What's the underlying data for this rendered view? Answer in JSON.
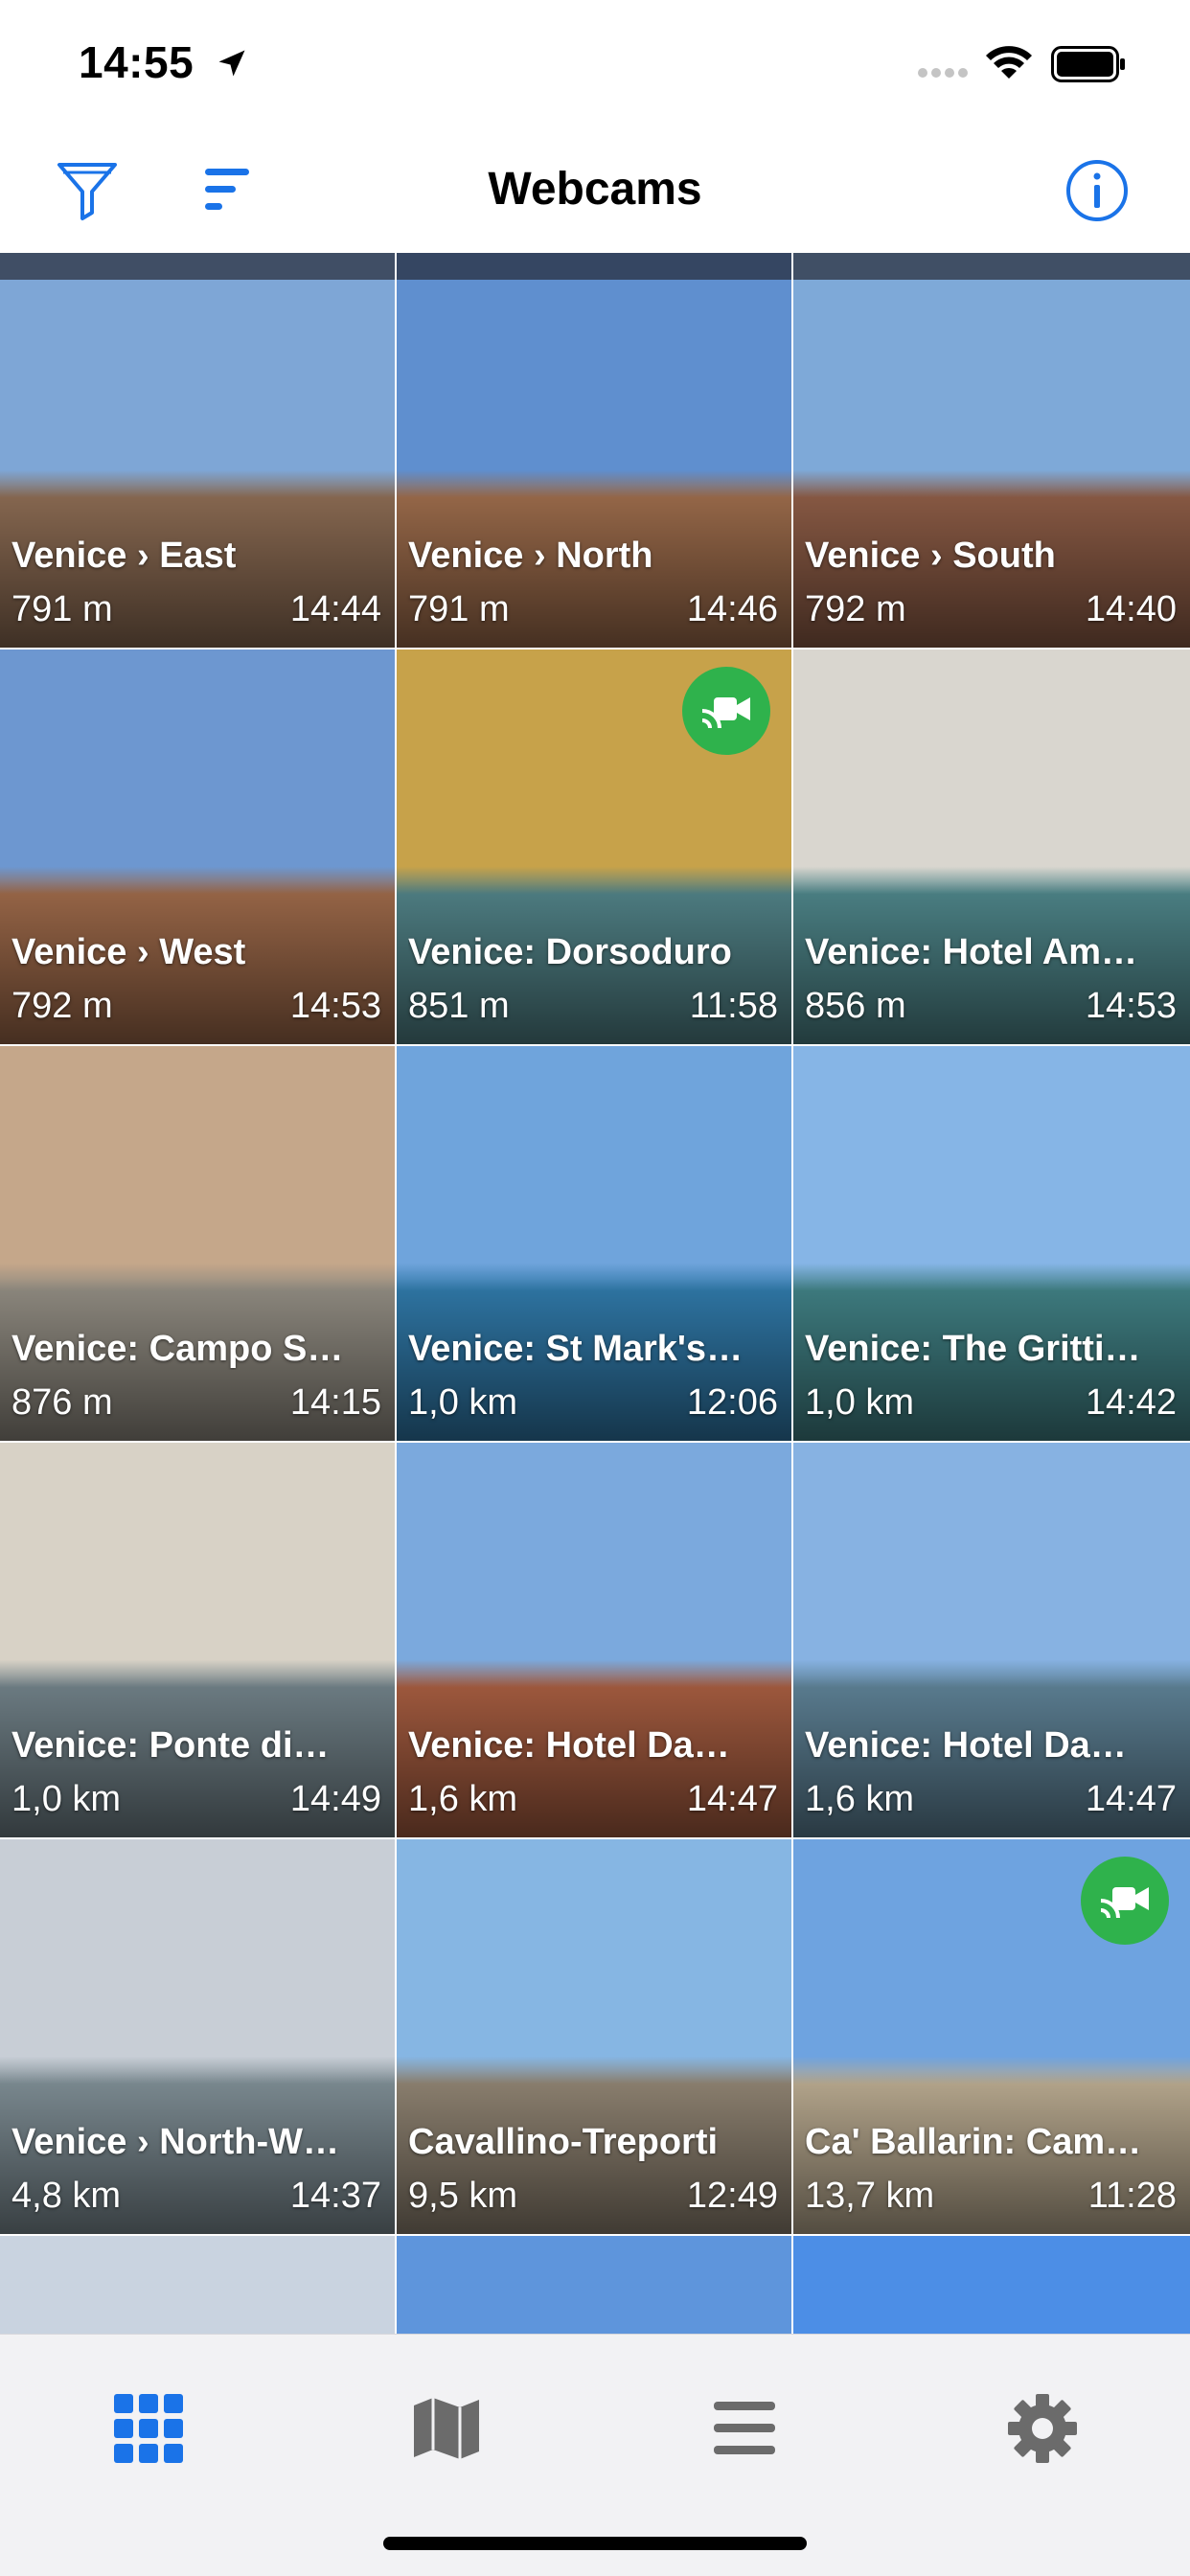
{
  "status_bar": {
    "time": "14:55"
  },
  "nav": {
    "title": "Webcams"
  },
  "webcams": [
    {
      "title": "Venice › East",
      "distance": "791 m",
      "time": "14:44",
      "stream": false,
      "sky": "#7ea6d6",
      "ground": "#8a6a52"
    },
    {
      "title": "Venice › North",
      "distance": "791 m",
      "time": "14:46",
      "stream": false,
      "sky": "#5f8fcf",
      "ground": "#9a6a4a"
    },
    {
      "title": "Venice › South",
      "distance": "792 m",
      "time": "14:40",
      "stream": false,
      "sky": "#7ea9d8",
      "ground": "#8b5b45"
    },
    {
      "title": "Venice › West",
      "distance": "792 m",
      "time": "14:53",
      "stream": false,
      "sky": "#6d97d0",
      "ground": "#9a6748"
    },
    {
      "title": "Venice: Dorsoduro",
      "distance": "851 m",
      "time": "11:58",
      "stream": true,
      "sky": "#c7a24a",
      "ground": "#4f7f84"
    },
    {
      "title": "Venice: Hotel Am…",
      "distance": "856 m",
      "time": "14:53",
      "stream": false,
      "sky": "#d9d6cf",
      "ground": "#4c8286"
    },
    {
      "title": "Venice: Campo S…",
      "distance": "876 m",
      "time": "14:15",
      "stream": false,
      "sky": "#c5a78a",
      "ground": "#8f8a80"
    },
    {
      "title": "Venice: St Mark's…",
      "distance": "1,0 km",
      "time": "12:06",
      "stream": false,
      "sky": "#6fa4dc",
      "ground": "#2f77a6"
    },
    {
      "title": "Venice: The Gritti…",
      "distance": "1,0 km",
      "time": "14:42",
      "stream": false,
      "sky": "#86b5e6",
      "ground": "#3f7e82"
    },
    {
      "title": "Venice: Ponte di…",
      "distance": "1,0 km",
      "time": "14:49",
      "stream": false,
      "sky": "#d8d2c6",
      "ground": "#6f7f86"
    },
    {
      "title": "Venice: Hotel Da…",
      "distance": "1,6 km",
      "time": "14:47",
      "stream": false,
      "sky": "#7ba9dd",
      "ground": "#a35b3f"
    },
    {
      "title": "Venice: Hotel Da…",
      "distance": "1,6 km",
      "time": "14:47",
      "stream": false,
      "sky": "#87b2e2",
      "ground": "#5c7f93"
    },
    {
      "title": "Venice › North-W…",
      "distance": "4,8 km",
      "time": "14:37",
      "stream": false,
      "sky": "#c8ced6",
      "ground": "#7d8c93"
    },
    {
      "title": "Cavallino-Treporti",
      "distance": "9,5 km",
      "time": "12:49",
      "stream": false,
      "sky": "#86b6e3",
      "ground": "#8e8271"
    },
    {
      "title": "Ca' Ballarin: Cam…",
      "distance": "13,7 km",
      "time": "11:28",
      "stream": true,
      "sky": "#6ea3e0",
      "ground": "#b8a98f"
    },
    {
      "title": "",
      "distance": "",
      "time": "",
      "stream": false,
      "sky": "#c9d3e0",
      "ground": "#c9d3e0"
    },
    {
      "title": "",
      "distance": "",
      "time": "",
      "stream": false,
      "sky": "#5e95dc",
      "ground": "#5e95dc"
    },
    {
      "title": "",
      "distance": "",
      "time": "",
      "stream": false,
      "sky": "#4c8ee6",
      "ground": "#4c8ee6"
    }
  ],
  "tabs": [
    {
      "name": "grid-icon",
      "active": true
    },
    {
      "name": "map-icon",
      "active": false
    },
    {
      "name": "list-icon",
      "active": false
    },
    {
      "name": "settings-icon",
      "active": false
    }
  ],
  "colors": {
    "accent": "#1a73e8",
    "stream_badge": "#2fb24c",
    "tab_inactive": "#6b6b6b"
  }
}
